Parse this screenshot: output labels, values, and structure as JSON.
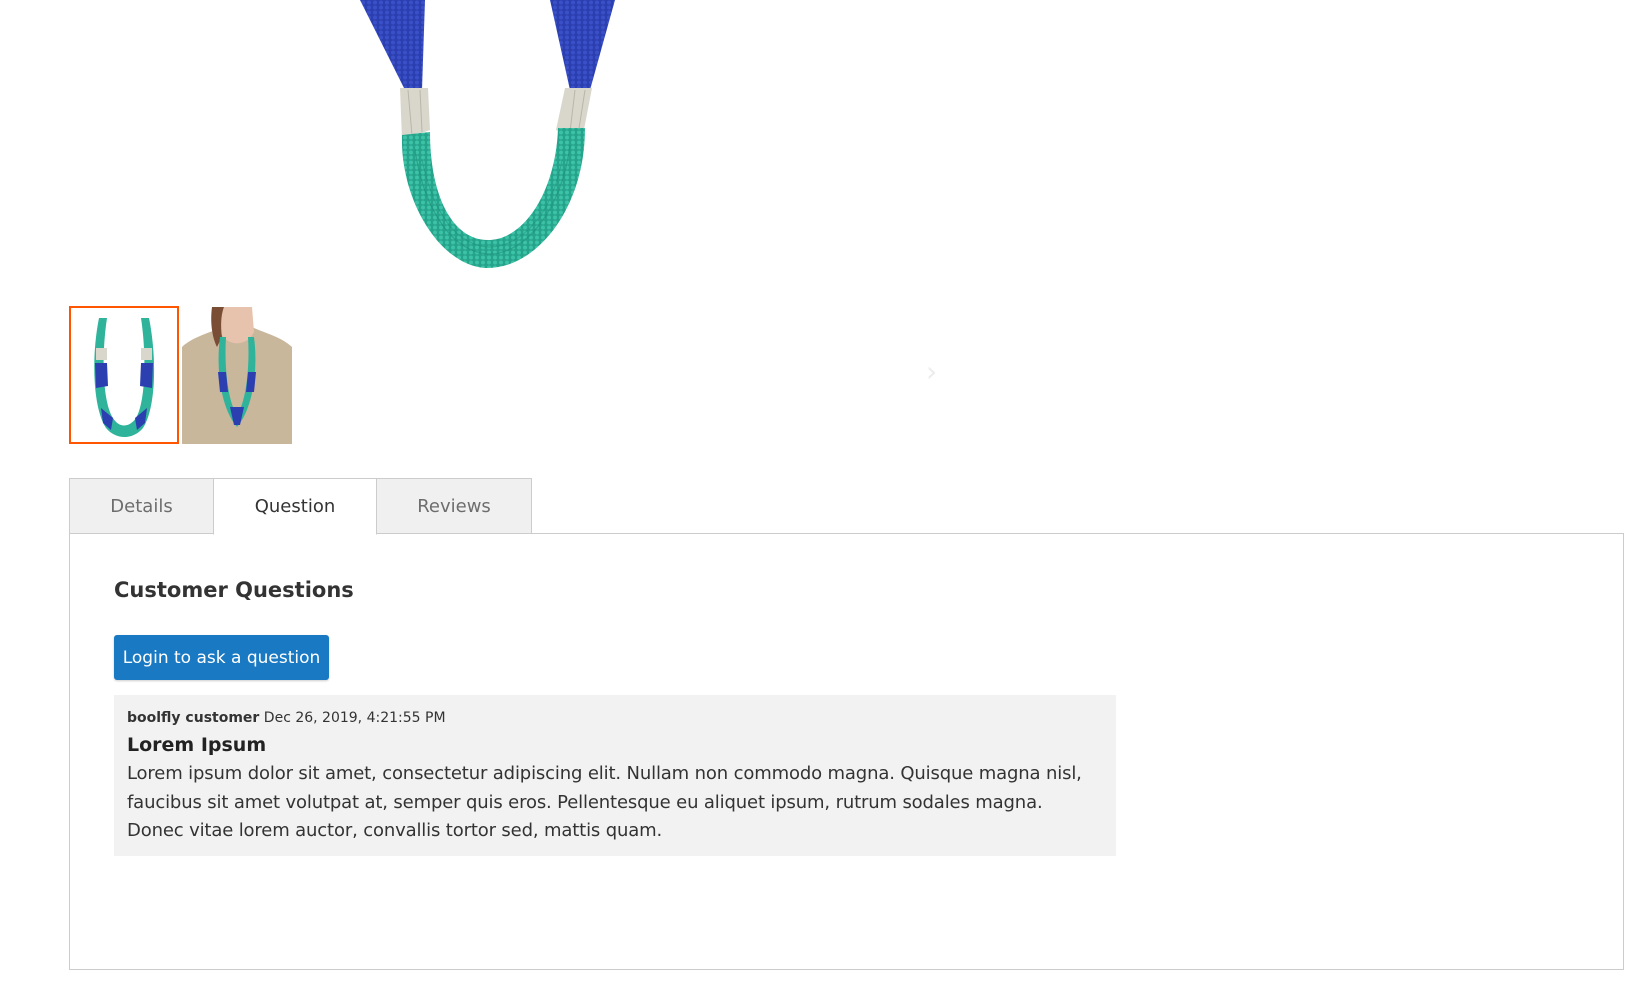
{
  "product_gallery": {
    "main_image": "beaded-necklace-image",
    "thumbnails": [
      {
        "name": "necklace-product-thumbnail",
        "selected": true
      },
      {
        "name": "necklace-model-thumbnail",
        "selected": false
      }
    ],
    "prev_icon": "chevron-left-icon",
    "next_icon": "chevron-right-icon",
    "prev_glyph": "‹",
    "next_glyph": "›"
  },
  "tabs": [
    {
      "label": "Details",
      "active": false
    },
    {
      "label": "Question",
      "active": true
    },
    {
      "label": "Reviews",
      "active": false
    }
  ],
  "questions": {
    "title": "Customer Questions",
    "login_button": "Login to ask a question",
    "items": [
      {
        "author": "boolfly customer",
        "date": "Dec 26, 2019, 4:21:55 PM",
        "title": "Lorem Ipsum",
        "body": "Lorem ipsum dolor sit amet, consectetur adipiscing elit. Nullam non commodo magna. Quisque magna nisl, faucibus sit amet volutpat at, semper quis eros. Pellentesque eu aliquet ipsum, rutrum sodales magna. Donec vitae lorem auctor, convallis tortor sed, mattis quam."
      }
    ]
  },
  "colors": {
    "accent": "#1979c3",
    "thumb_selected_border": "#ff5501",
    "card_background": "#f2f2f2",
    "tab_inactive": "#f0f0f0",
    "necklace_blue": "#2b3fb0",
    "necklace_teal": "#2fb39a",
    "necklace_silver": "#d9d7cc"
  }
}
